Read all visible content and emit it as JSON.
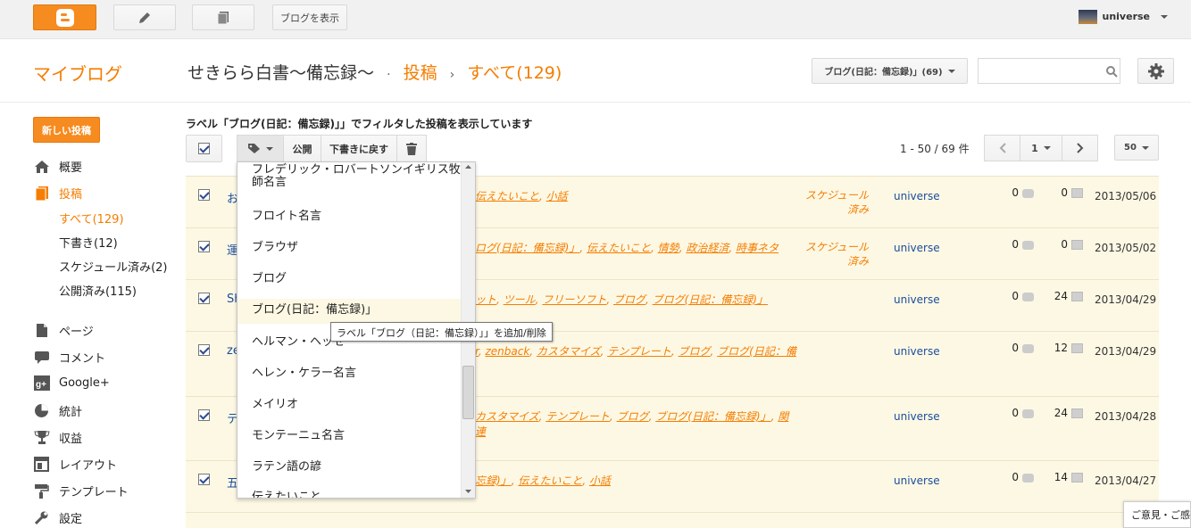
{
  "topbar": {
    "view_blog": "ブログを表示",
    "username": "universe"
  },
  "header": {
    "my_blog": "マイブログ",
    "blog_title": "せきらら白書〜備忘録〜",
    "separator": "·",
    "section": "投稿",
    "arrow": "›",
    "current": "すべて(129)",
    "label_select": "ブログ(日記：備忘録)」(69)"
  },
  "sidebar": {
    "new_post": "新しい投稿",
    "overview": "概要",
    "posts": "投稿",
    "sub": {
      "all": "すべて(129)",
      "drafts": "下書き(12)",
      "scheduled": "スケジュール済み(2)",
      "published": "公開済み(115)"
    },
    "pages": "ページ",
    "comments": "コメント",
    "google_plus": "Google+",
    "stats": "統計",
    "earnings": "収益",
    "layout": "レイアウト",
    "template": "テンプレート",
    "settings": "設定"
  },
  "filter_text": "ラベル「ブログ(日記：備忘録)」」でフィルタした投稿を表示しています",
  "toolbar": {
    "publish": "公開",
    "revert_draft": "下書きに戻す",
    "range": "1 - 50 / 69 件",
    "page": "1",
    "per_page": "50"
  },
  "posts": [
    {
      "title": "お",
      "labels": [
        "伝えたいこと",
        "小話"
      ],
      "status": "スケジュール済み",
      "author": "universe",
      "comments": "0",
      "views": "0",
      "date": "2013/05/06"
    },
    {
      "title": "運",
      "labels": [
        "ログ(日記：備忘録)」",
        "伝えたいこと",
        "情勢",
        "政治経済",
        "時事ネタ"
      ],
      "status": "スケジュール済み",
      "author": "universe",
      "comments": "0",
      "views": "0",
      "date": "2013/05/02"
    },
    {
      "title": "Sh",
      "labels": [
        "ット",
        "ツール",
        "フリーソフト",
        "ブログ",
        "ブログ(日記：備忘録)」"
      ],
      "status": "",
      "author": "universe",
      "comments": "0",
      "views": "24",
      "date": "2013/04/29"
    },
    {
      "title": "ze",
      "labels": [
        "r",
        "zenback",
        "カスタマイズ",
        "テンプレート",
        "ブログ",
        "ブログ(日記：備"
      ],
      "status": "",
      "author": "universe",
      "comments": "0",
      "views": "12",
      "date": "2013/04/29"
    },
    {
      "title": "テ",
      "labels": [
        "カスタマイズ",
        "テンプレート",
        "ブログ",
        "ブログ(日記：備忘録)」",
        "関連"
      ],
      "status": "",
      "author": "universe",
      "comments": "0",
      "views": "24",
      "date": "2013/04/28"
    },
    {
      "title": "五",
      "labels": [
        "忘録)」",
        "伝えたいこと",
        "小話"
      ],
      "status": "",
      "author": "universe",
      "comments": "0",
      "views": "14",
      "date": "2013/04/27"
    }
  ],
  "label_menu": [
    "フレデリック・ロバートソンイギリス牧師名言",
    "フロイト名言",
    "ブラウザ",
    "ブログ",
    "ブログ(日記：備忘録)」",
    "ヘルマン・ヘッセ",
    "ヘレン・ケラー名言",
    "メイリオ",
    "モンテーニュ名言",
    "ラテン語の諺",
    "伝えたいこと"
  ],
  "tooltip": "ラベル「ブログ（日記：備忘録）」」を追加/削除",
  "feedback": "ご意見・ご感想",
  "colors": {
    "accent": "#f57d00",
    "link": "#1a4d9c",
    "row_bg": "#fdf8e4"
  }
}
